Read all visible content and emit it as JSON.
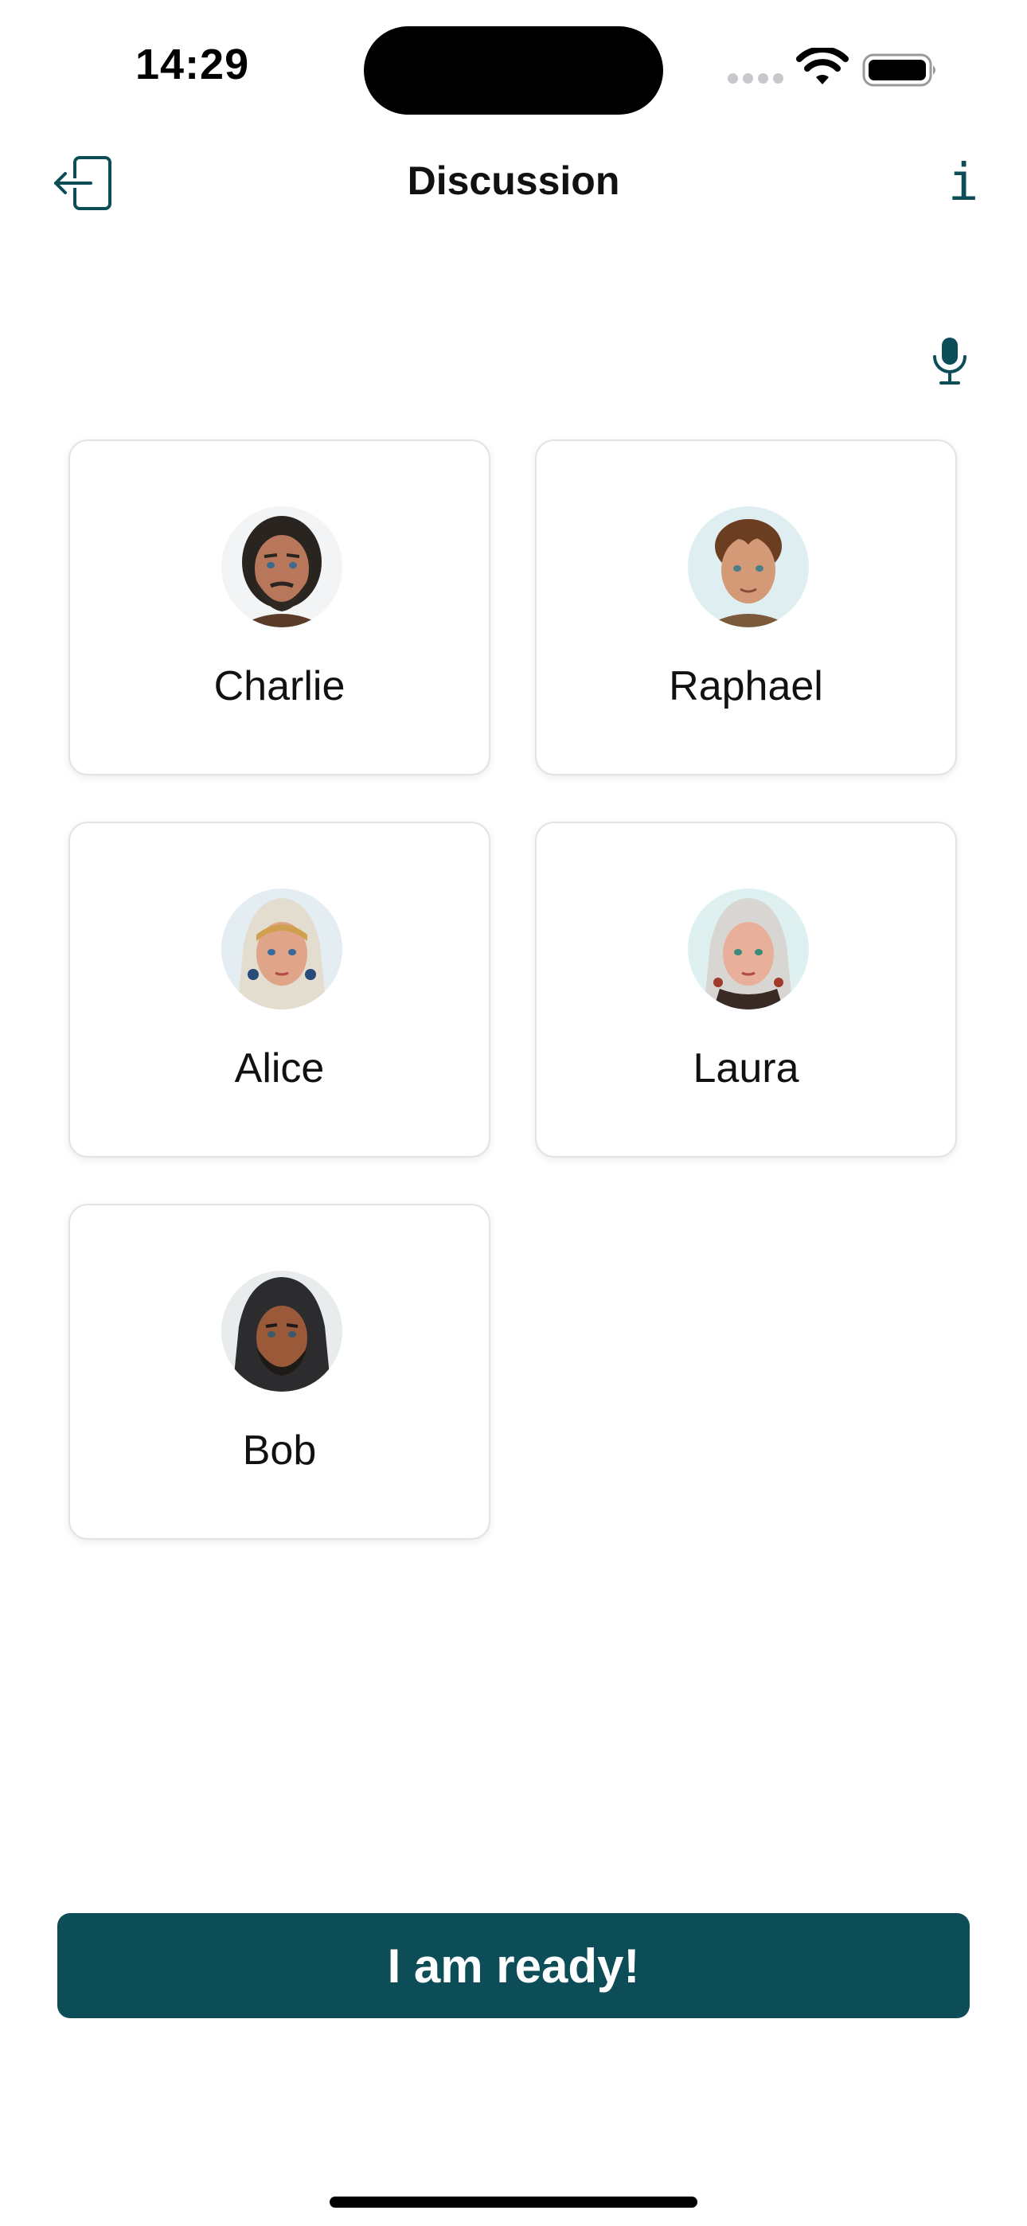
{
  "status_bar": {
    "time": "14:29",
    "icons": [
      "cellular-signal-icon",
      "wifi-icon",
      "battery-icon"
    ]
  },
  "header": {
    "title": "Discussion",
    "exit_icon": "exit-icon",
    "info_label": "i"
  },
  "mic_icon": "microphone-icon",
  "participants": [
    {
      "name": "Charlie",
      "avatar": "bearded-man-portrait"
    },
    {
      "name": "Raphael",
      "avatar": "young-man-portrait"
    },
    {
      "name": "Alice",
      "avatar": "hooded-woman-portrait"
    },
    {
      "name": "Laura",
      "avatar": "hooded-woman-portrait"
    },
    {
      "name": "Bob",
      "avatar": "dark-hooded-man-portrait"
    }
  ],
  "ready_button": {
    "label": "I am ready!"
  },
  "colors": {
    "accent": "#0c4d57",
    "card_border": "#e3e3e3",
    "background": "#ffffff"
  }
}
